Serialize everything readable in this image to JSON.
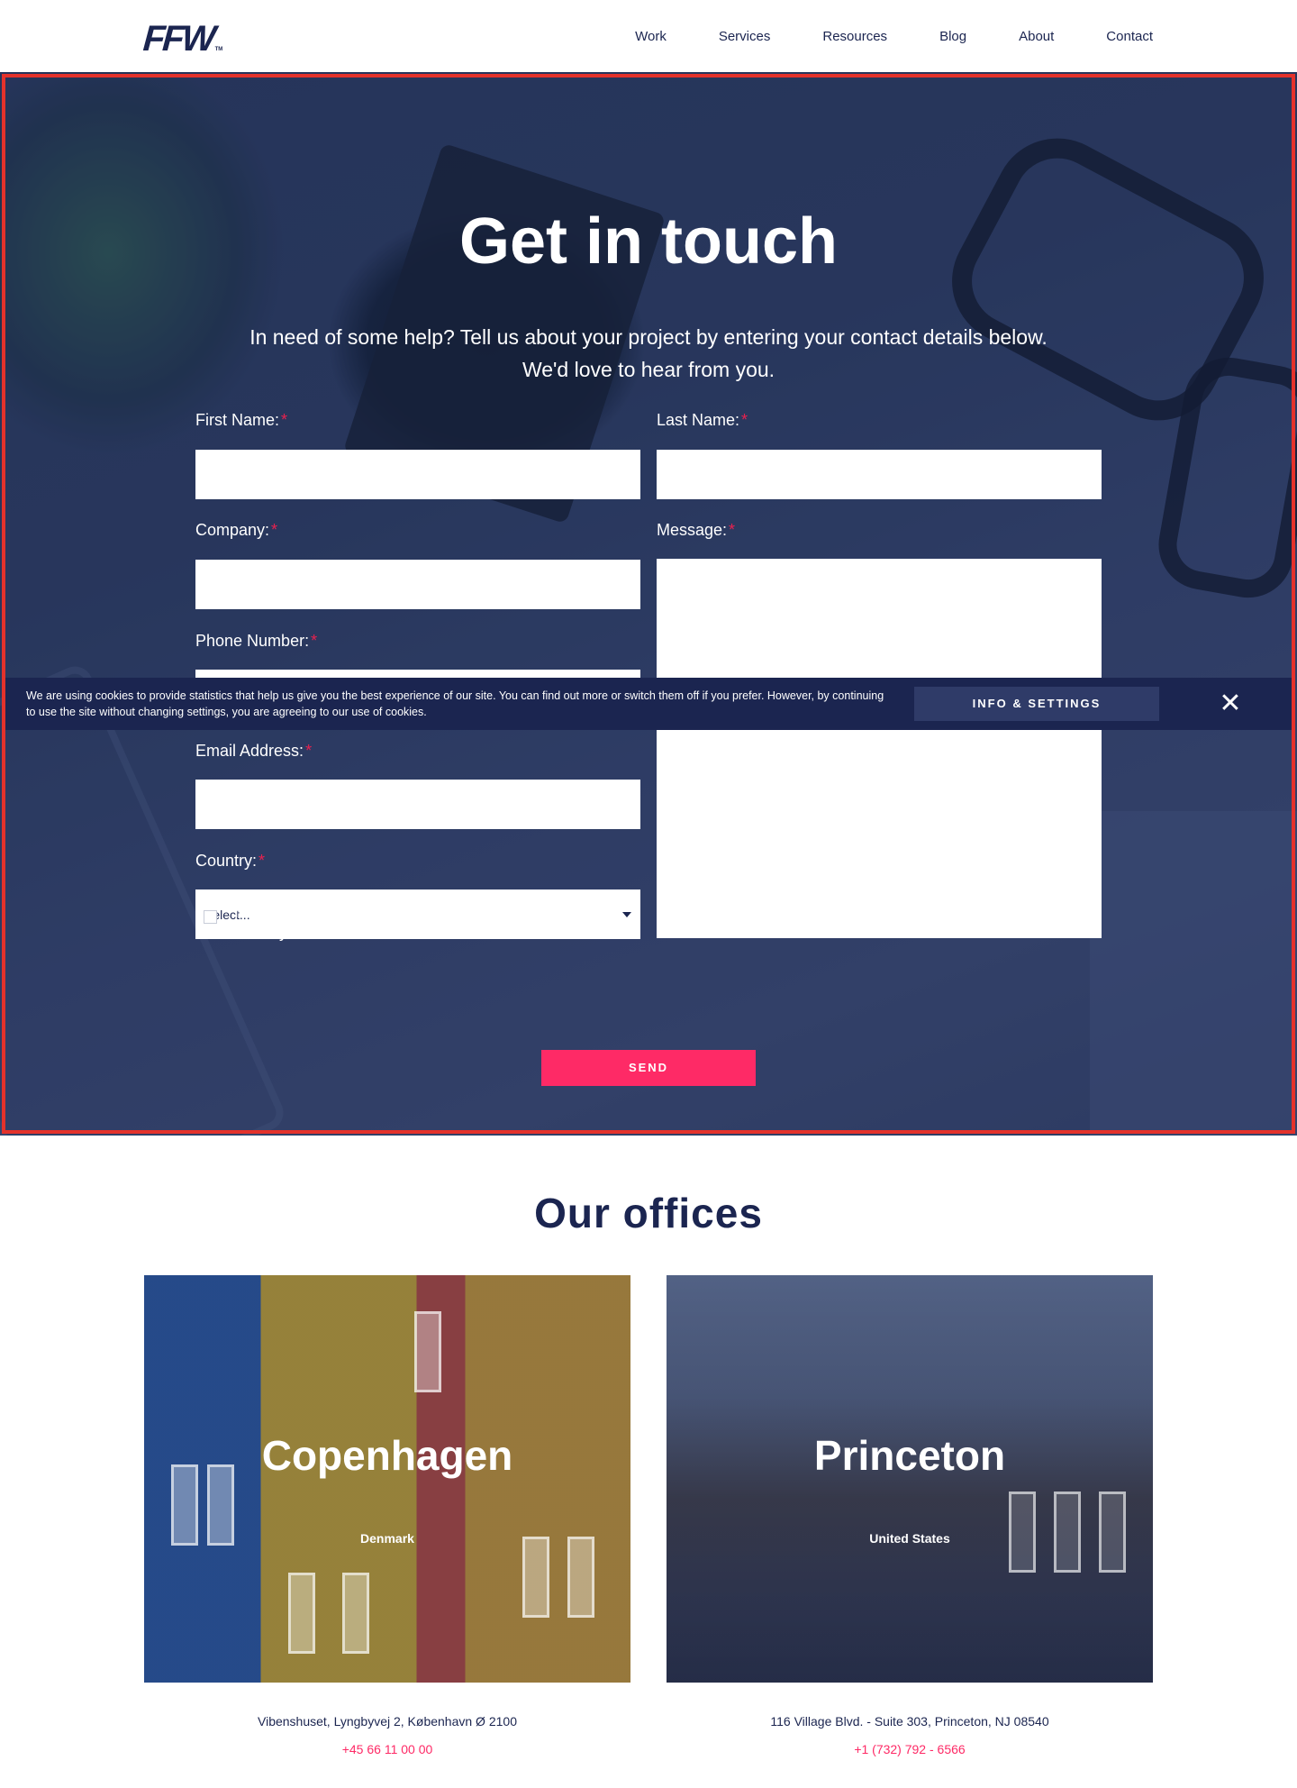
{
  "header": {
    "logo": "FFW",
    "logo_tm": "TM",
    "nav": [
      "Work",
      "Services",
      "Resources",
      "Blog",
      "About",
      "Contact"
    ]
  },
  "hero": {
    "title": "Get in touch",
    "subtitle_line1": "In need of some help? Tell us about your project by entering your contact details below.",
    "subtitle_line2": "We'd love to hear from you."
  },
  "form": {
    "first_name_label": "First Name:",
    "last_name_label": "Last Name:",
    "company_label": "Company:",
    "message_label": "Message:",
    "phone_label": "Phone Number:",
    "email_label": "Email Address:",
    "country_label": "Country:",
    "country_value": "Select...",
    "required_mark": "*",
    "consent_prefix": "I have read and agree to the ",
    "terms_link": "Terms & Conditions",
    "and1": " and ",
    "privacy_link": "Privacy",
    "and2": " and ",
    "cookies_link": "Cookies notice",
    "send_label": "SEND"
  },
  "cookie_bar": {
    "text": "We are using cookies to provide statistics that help us give you the best experience of our site. You can find out more or switch them off if you prefer. However, by continuing to use the site without changing settings, you are agreeing to our use of cookies.",
    "button": "INFO & SETTINGS",
    "close": "✕"
  },
  "offices": {
    "title": "Our offices",
    "items": [
      {
        "city": "Copenhagen",
        "country": "Denmark",
        "address": "Vibenshuset, Lyngbyvej 2, København Ø 2100",
        "phone": "+45 66 11 00 00"
      },
      {
        "city": "Princeton",
        "country": "United States",
        "address": "116 Village Blvd. - Suite 303, Princeton, NJ 08540",
        "phone": "+1 (732) 792 - 6566"
      }
    ]
  },
  "colors": {
    "navy": "#1b2550",
    "accent_pink": "#fe2a66",
    "highlight_frame": "#e4322b"
  }
}
